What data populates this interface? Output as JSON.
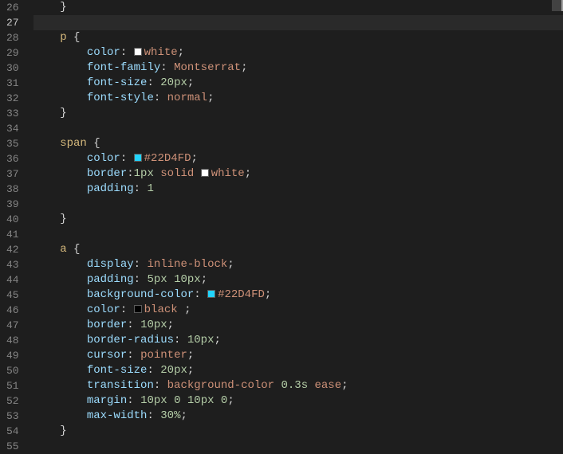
{
  "startLine": 26,
  "activeLine": 27,
  "colors": {
    "white": "#ffffff",
    "accent": "#22D4FD",
    "black": "#000000"
  },
  "lines": [
    {
      "n": 26,
      "indent": 1,
      "tokens": [
        {
          "t": "}",
          "c": "brace"
        }
      ]
    },
    {
      "n": 27,
      "indent": 0,
      "tokens": [],
      "active": true
    },
    {
      "n": 28,
      "indent": 1,
      "tokens": [
        {
          "t": "p",
          "c": "selector"
        },
        {
          "t": " ",
          "c": "punc"
        },
        {
          "t": "{",
          "c": "brace"
        }
      ]
    },
    {
      "n": 29,
      "indent": 2,
      "tokens": [
        {
          "t": "color",
          "c": "prop"
        },
        {
          "t": ": ",
          "c": "punc"
        },
        {
          "swatch": "white"
        },
        {
          "t": "white",
          "c": "value"
        },
        {
          "t": ";",
          "c": "punc"
        }
      ]
    },
    {
      "n": 30,
      "indent": 2,
      "tokens": [
        {
          "t": "font-family",
          "c": "prop"
        },
        {
          "t": ": ",
          "c": "punc"
        },
        {
          "t": "Montserrat",
          "c": "value"
        },
        {
          "t": ";",
          "c": "punc"
        }
      ]
    },
    {
      "n": 31,
      "indent": 2,
      "tokens": [
        {
          "t": "font-size",
          "c": "prop"
        },
        {
          "t": ": ",
          "c": "punc"
        },
        {
          "t": "20px",
          "c": "number"
        },
        {
          "t": ";",
          "c": "punc"
        }
      ]
    },
    {
      "n": 32,
      "indent": 2,
      "tokens": [
        {
          "t": "font-style",
          "c": "prop"
        },
        {
          "t": ": ",
          "c": "punc"
        },
        {
          "t": "normal",
          "c": "value"
        },
        {
          "t": ";",
          "c": "punc"
        }
      ]
    },
    {
      "n": 33,
      "indent": 1,
      "tokens": [
        {
          "t": "}",
          "c": "brace"
        }
      ]
    },
    {
      "n": 34,
      "indent": 0,
      "tokens": []
    },
    {
      "n": 35,
      "indent": 1,
      "tokens": [
        {
          "t": "span",
          "c": "selector"
        },
        {
          "t": " ",
          "c": "punc"
        },
        {
          "t": "{",
          "c": "brace"
        }
      ]
    },
    {
      "n": 36,
      "indent": 2,
      "tokens": [
        {
          "t": "color",
          "c": "prop"
        },
        {
          "t": ": ",
          "c": "punc"
        },
        {
          "swatch": "accent"
        },
        {
          "t": "#22D4FD",
          "c": "value"
        },
        {
          "t": ";",
          "c": "punc"
        }
      ]
    },
    {
      "n": 37,
      "indent": 2,
      "tokens": [
        {
          "t": "border",
          "c": "prop"
        },
        {
          "t": ":",
          "c": "punc"
        },
        {
          "t": "1px",
          "c": "number"
        },
        {
          "t": " ",
          "c": "punc"
        },
        {
          "t": "solid",
          "c": "value"
        },
        {
          "t": " ",
          "c": "punc"
        },
        {
          "swatch": "white"
        },
        {
          "t": "white",
          "c": "value"
        },
        {
          "t": ";",
          "c": "punc"
        }
      ]
    },
    {
      "n": 38,
      "indent": 2,
      "tokens": [
        {
          "t": "padding",
          "c": "prop"
        },
        {
          "t": ": ",
          "c": "punc"
        },
        {
          "t": "1",
          "c": "number"
        }
      ]
    },
    {
      "n": 39,
      "indent": 0,
      "tokens": []
    },
    {
      "n": 40,
      "indent": 1,
      "tokens": [
        {
          "t": "}",
          "c": "brace"
        }
      ]
    },
    {
      "n": 41,
      "indent": 0,
      "tokens": []
    },
    {
      "n": 42,
      "indent": 1,
      "tokens": [
        {
          "t": "a",
          "c": "selector"
        },
        {
          "t": " ",
          "c": "punc"
        },
        {
          "t": "{",
          "c": "brace"
        }
      ]
    },
    {
      "n": 43,
      "indent": 2,
      "tokens": [
        {
          "t": "display",
          "c": "prop"
        },
        {
          "t": ": ",
          "c": "punc"
        },
        {
          "t": "inline-block",
          "c": "value"
        },
        {
          "t": ";",
          "c": "punc"
        }
      ]
    },
    {
      "n": 44,
      "indent": 2,
      "tokens": [
        {
          "t": "padding",
          "c": "prop"
        },
        {
          "t": ": ",
          "c": "punc"
        },
        {
          "t": "5px",
          "c": "number"
        },
        {
          "t": " ",
          "c": "punc"
        },
        {
          "t": "10px",
          "c": "number"
        },
        {
          "t": ";",
          "c": "punc"
        }
      ]
    },
    {
      "n": 45,
      "indent": 2,
      "tokens": [
        {
          "t": "background-color",
          "c": "prop"
        },
        {
          "t": ": ",
          "c": "punc"
        },
        {
          "swatch": "accent"
        },
        {
          "t": "#22D4FD",
          "c": "value"
        },
        {
          "t": ";",
          "c": "punc"
        }
      ]
    },
    {
      "n": 46,
      "indent": 2,
      "tokens": [
        {
          "t": "color",
          "c": "prop"
        },
        {
          "t": ": ",
          "c": "punc"
        },
        {
          "swatch": "black"
        },
        {
          "t": "black",
          "c": "value"
        },
        {
          "t": " ;",
          "c": "punc"
        }
      ]
    },
    {
      "n": 47,
      "indent": 2,
      "tokens": [
        {
          "t": "border",
          "c": "prop"
        },
        {
          "t": ": ",
          "c": "punc"
        },
        {
          "t": "10px",
          "c": "number"
        },
        {
          "t": ";",
          "c": "punc"
        }
      ]
    },
    {
      "n": 48,
      "indent": 2,
      "tokens": [
        {
          "t": "border-radius",
          "c": "prop"
        },
        {
          "t": ": ",
          "c": "punc"
        },
        {
          "t": "10px",
          "c": "number"
        },
        {
          "t": ";",
          "c": "punc"
        }
      ]
    },
    {
      "n": 49,
      "indent": 2,
      "tokens": [
        {
          "t": "cursor",
          "c": "prop"
        },
        {
          "t": ": ",
          "c": "punc"
        },
        {
          "t": "pointer",
          "c": "value"
        },
        {
          "t": ";",
          "c": "punc"
        }
      ]
    },
    {
      "n": 50,
      "indent": 2,
      "tokens": [
        {
          "t": "font-size",
          "c": "prop"
        },
        {
          "t": ": ",
          "c": "punc"
        },
        {
          "t": "20px",
          "c": "number"
        },
        {
          "t": ";",
          "c": "punc"
        }
      ]
    },
    {
      "n": 51,
      "indent": 2,
      "tokens": [
        {
          "t": "transition",
          "c": "prop"
        },
        {
          "t": ": ",
          "c": "punc"
        },
        {
          "t": "background-color",
          "c": "value"
        },
        {
          "t": " ",
          "c": "punc"
        },
        {
          "t": "0.3s",
          "c": "number"
        },
        {
          "t": " ",
          "c": "punc"
        },
        {
          "t": "ease",
          "c": "value"
        },
        {
          "t": ";",
          "c": "punc"
        }
      ]
    },
    {
      "n": 52,
      "indent": 2,
      "tokens": [
        {
          "t": "margin",
          "c": "prop"
        },
        {
          "t": ": ",
          "c": "punc"
        },
        {
          "t": "10px",
          "c": "number"
        },
        {
          "t": " ",
          "c": "punc"
        },
        {
          "t": "0",
          "c": "number"
        },
        {
          "t": " ",
          "c": "punc"
        },
        {
          "t": "10px",
          "c": "number"
        },
        {
          "t": " ",
          "c": "punc"
        },
        {
          "t": "0",
          "c": "number"
        },
        {
          "t": ";",
          "c": "punc"
        }
      ]
    },
    {
      "n": 53,
      "indent": 2,
      "tokens": [
        {
          "t": "max-width",
          "c": "prop"
        },
        {
          "t": ": ",
          "c": "punc"
        },
        {
          "t": "30%",
          "c": "number"
        },
        {
          "t": ";",
          "c": "punc"
        }
      ]
    },
    {
      "n": 54,
      "indent": 1,
      "tokens": [
        {
          "t": "}",
          "c": "brace"
        }
      ]
    },
    {
      "n": 55,
      "indent": 0,
      "tokens": []
    }
  ]
}
